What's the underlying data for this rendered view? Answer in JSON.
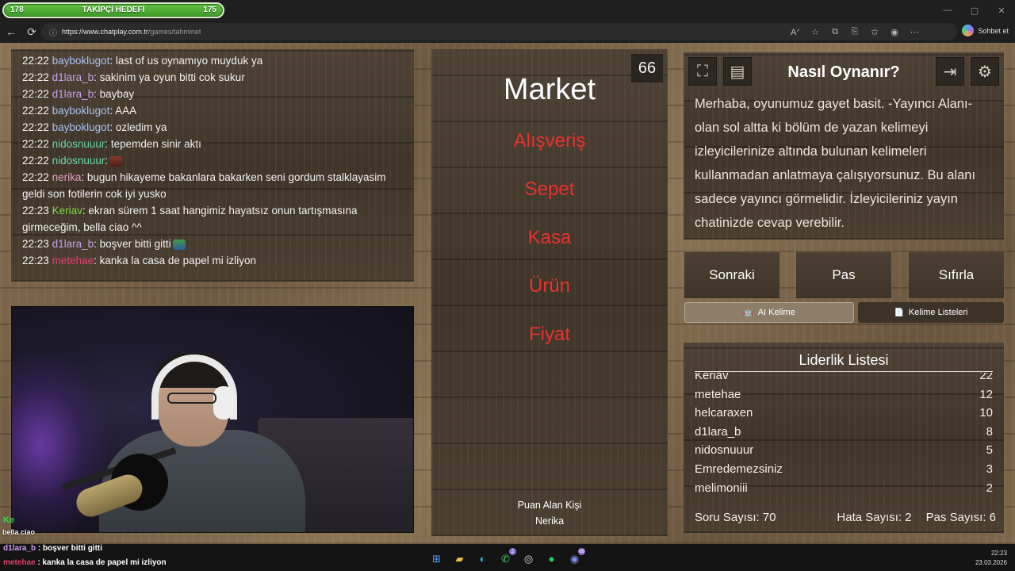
{
  "titlebar": {
    "follow_goal": {
      "min": "178",
      "title": "TAKİPÇİ HEDEFİ",
      "max": "175"
    },
    "window_controls": [
      "—",
      "▢",
      "✕"
    ]
  },
  "browser": {
    "url_host": "https://www.chatplay.com.tr",
    "url_path": "/games/tahminet",
    "chat_button": "Sohbet et"
  },
  "chat": {
    "messages": [
      {
        "time": "22:22",
        "user": "bayboklugot",
        "user_color": "#a9c1f2",
        "text": ": last of us oynamıyo muyduk ya"
      },
      {
        "time": "22:22",
        "user": "d1lara_b",
        "user_color": "#c9a0f0",
        "text": ": sakinim ya oyun bitti cok sukur"
      },
      {
        "time": "22:22",
        "user": "d1lara_b",
        "user_color": "#c9a0f0",
        "text": ": baybay"
      },
      {
        "time": "22:22",
        "user": "bayboklugot",
        "user_color": "#a9c1f2",
        "text": ": AAA"
      },
      {
        "time": "22:22",
        "user": "bayboklugot",
        "user_color": "#a9c1f2",
        "text": ": ozledim ya"
      },
      {
        "time": "22:22",
        "user": "nidosnuuur",
        "user_color": "#6fd6a8",
        "text": ": tepemden sinir aktı"
      },
      {
        "time": "22:22",
        "user": "nidosnuuur",
        "user_color": "#6fd6a8",
        "text": ":"
      },
      {
        "time": "22:22",
        "user": "nerika",
        "user_color": "#e6a0c8",
        "text": ": bugun hikayeme bakanlara bakarken seni gordum stalklayasim geldi son fotilerin cok iyi yusko"
      },
      {
        "time": "22:23",
        "user": "Keriav",
        "user_color": "#7ddc3f",
        "text": ": ekran sürem 1 saat hangimiz hayatsız onun tartışmasına girmeceğim, bella ciao ^^"
      },
      {
        "time": "22:23",
        "user": "d1lara_b",
        "user_color": "#c9a0f0",
        "text": ": boşver bitti gitti"
      },
      {
        "time": "22:23",
        "user": "metehae",
        "user_color": "#e0406a",
        "text": ": kanka la casa de papel mi izliyon"
      }
    ],
    "overlay_ke": "Ke",
    "overlay_bella": "bella ciao"
  },
  "market": {
    "title": "Market",
    "count": "66",
    "forbidden_words": [
      "Alışveriş",
      "Sepet",
      "Kasa",
      "Ürün",
      "Fiyat"
    ],
    "scorer_label": "Puan Alan Kişi",
    "scorer_name": "Nerika"
  },
  "info": {
    "title": "Nasıl Oynanır?",
    "text": "Merhaba, oyunumuz gayet basit. -Yayıncı Alanı- olan sol altta ki bölüm de yazan kelimeyi izleyicilerinize altında bulunan kelimeleri kullanmadan anlatmaya çalışıyorsunuz. Bu alanı sadece yayıncı görmelidir. İzleyicileriniz yayın chatinizde cevap verebilir.",
    "icons": [
      "fullscreen-icon",
      "notes-icon",
      "exit-icon",
      "gear-icon"
    ]
  },
  "controls": {
    "next": "Sonraki",
    "pass": "Pas",
    "reset": "Sıfırla",
    "ai_word": "AI Kelime",
    "word_lists": "Kelime Listeleri"
  },
  "leaderboard": {
    "title": "Liderlik Listesi",
    "rows": [
      {
        "name": "Keriav",
        "score": "22"
      },
      {
        "name": "metehae",
        "score": "12"
      },
      {
        "name": "helcaraxen",
        "score": "10"
      },
      {
        "name": "d1lara_b",
        "score": "8"
      },
      {
        "name": "nidosnuuur",
        "score": "5"
      },
      {
        "name": "Emredemezsiniz",
        "score": "3"
      },
      {
        "name": "melimoniii",
        "score": "2"
      }
    ],
    "question_count": "Soru Sayısı: 70",
    "error_count": "Hata Sayısı: 2",
    "pass_count": "Pas Sayısı: 6"
  },
  "bottom_chat": [
    {
      "user": "d1lara_b",
      "text": " : boşver bitti gitti"
    },
    {
      "user": "metehae",
      "text": " : kanka la casa de papel mi izliyon"
    }
  ],
  "taskbar": {
    "time": "22:23",
    "date": "23.03.2026",
    "badges": {
      "whatsapp": "2",
      "discord": "99"
    }
  }
}
